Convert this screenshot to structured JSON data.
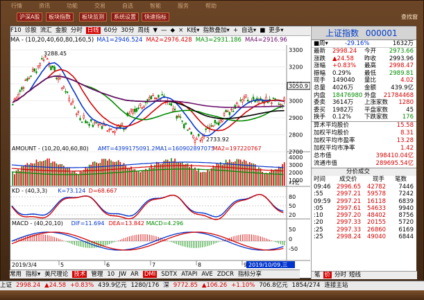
{
  "topmenu": {
    "buttons": [
      "沪深A股",
      "板块指数",
      "板块监测",
      "系统设置",
      "快速指标"
    ],
    "faint": [
      "行情",
      "资讯",
      "功能",
      "交易",
      "自选",
      "智能",
      "服务",
      "帮助"
    ],
    "corner": "查找窗"
  },
  "toolbar": {
    "items": [
      "F10",
      "诊股",
      "流汇",
      "金股",
      "分时",
      "日线",
      "60分",
      "30分",
      "周线",
      "▼",
      "—",
      "◆",
      "×",
      "K线▾",
      "指数叠加▾",
      "+",
      "自选▾",
      "■",
      "更多▾"
    ],
    "selected_index": 5
  },
  "ma_bar": {
    "label": "MA - (10,20,40,60,80,160,5)",
    "items": [
      {
        "text": "MA1=2946.524",
        "color": "#0033cc"
      },
      {
        "text": "MA2=2976.428",
        "color": "#d40000"
      },
      {
        "text": "MA3=2931.186",
        "color": "#008a00"
      },
      {
        "text": "MA4=2916.96",
        "color": "#6a0d6a"
      }
    ]
  },
  "price_axis": [
    "3300",
    "3200",
    "3100",
    "3000",
    "2900",
    "2800",
    "2700"
  ],
  "price_markers": {
    "high": "3288.45",
    "low": "2733.92",
    "current": "3050.9"
  },
  "volume_bar": {
    "label": "AMOUNT - (10,20,40,60,80)",
    "items": [
      {
        "text": "AMT=4399175091.2",
        "color": "#0033cc"
      },
      {
        "text": "MA1=160902897075",
        "color": "#0033cc"
      },
      {
        "text": "MA2=197220767",
        "color": "#d40000"
      }
    ],
    "axis": [
      "4000",
      "3000",
      "2000",
      "1000"
    ],
    "unit": "x1亿"
  },
  "kd_bar": {
    "label": "KD - (40,3,3)",
    "items": [
      {
        "text": "K=73.124",
        "color": "#0033cc"
      },
      {
        "text": "D=68.667",
        "color": "#d40000"
      }
    ],
    "axis": [
      "80",
      "50",
      "20"
    ]
  },
  "macd_bar": {
    "label": "MACD - (40,20,10)",
    "items": [
      {
        "text": "DIF=11.694",
        "color": "#0033cc"
      },
      {
        "text": "DEA=13.842",
        "color": "#d40000"
      },
      {
        "text": "MACD=4.296",
        "color": "#008a00"
      }
    ],
    "axis": [
      "50",
      "0",
      "-50"
    ]
  },
  "date_axis": {
    "left": "2019/3/4",
    "months": [
      "5",
      "6",
      "7",
      "8",
      "9"
    ],
    "highlight": "2019/10/09,三"
  },
  "side": {
    "title": "上证指数",
    "code": "000001",
    "week_selector": "■周▾",
    "change_pct_top": "-29.16%",
    "volume_top": "1632万",
    "quote": [
      {
        "l1": "最新",
        "v1": "2998.24",
        "c1": "red",
        "l2": "今开",
        "v2": "2973.66",
        "c2": "green"
      },
      {
        "l1": "涨跌",
        "v1": "▲24.58",
        "c1": "red",
        "l2": "昨收",
        "v2": "2993.96",
        "c2": "black"
      },
      {
        "l1": "涨幅",
        "v1": "+0.83%",
        "c1": "red",
        "l2": "最高",
        "v2": "2998.47",
        "c2": "red"
      },
      {
        "l1": "振幅",
        "v1": "0.29%",
        "c1": "black",
        "l2": "最低",
        "v2": "2989.81",
        "c2": "green"
      },
      {
        "l1": "现手",
        "v1": "149040",
        "c1": "black",
        "l2": "量比",
        "v2": "4.02",
        "c2": "red"
      },
      {
        "l1": "总量",
        "v1": "4026万",
        "c1": "black",
        "l2": "金额",
        "v2": "439.9亿",
        "c2": "black"
      },
      {
        "l1": "内盘",
        "v1": "18476980",
        "c1": "green",
        "l2": "外盘",
        "v2": "21784468",
        "c2": "red"
      },
      {
        "l1": "委卖",
        "v1": "3614万",
        "c1": "black",
        "l2": "上涨家数",
        "v2": "1280",
        "c2": "red"
      },
      {
        "l1": "委买",
        "v1": "1982万",
        "c1": "black",
        "l2": "平盘家数",
        "v2": "45",
        "c2": "black"
      },
      {
        "l1": "换手",
        "v1": "0.12%",
        "c1": "black",
        "l2": "下跌家数",
        "v2": "176",
        "c2": "green"
      }
    ],
    "stats": [
      {
        "label": "算术平均股价",
        "value": "15.58"
      },
      {
        "label": "加权平均股价",
        "value": "8.31"
      },
      {
        "label": "加权平均市盈率",
        "value": "13.28"
      },
      {
        "label": "加权平均市净率",
        "value": "1.42"
      },
      {
        "label": "总市值",
        "value": "398410.04亿"
      },
      {
        "label": "流通市值",
        "value": "289695.54亿"
      }
    ],
    "ticks_header": {
      "title": "分价成交",
      "cols": [
        "时间",
        "成交价",
        "现手",
        "笔数"
      ]
    },
    "ticks": [
      {
        "time": "09:46",
        "price": "2996.65",
        "vol": "42782",
        "count": "7446"
      },
      {
        "time": ":55",
        "price": "2997.21",
        "vol": "59578",
        "count": "7242"
      },
      {
        "time": "09:59",
        "price": "2997.21",
        "vol": "16118",
        "count": "6839"
      },
      {
        "time": ":05",
        "price": "2997.61",
        "vol": "54633",
        "count": "9940"
      },
      {
        "time": ":10",
        "price": "2997.20",
        "vol": "48402",
        "count": "8756"
      },
      {
        "time": ":20",
        "price": "2997.33",
        "vol": "20155",
        "count": "5720"
      },
      {
        "time": ":25",
        "price": "2997.33",
        "vol": "26860",
        "count": "6169"
      },
      {
        "time": ":25",
        "price": "2998.24",
        "vol": "49040",
        "count": "6844"
      }
    ],
    "tabs": [
      "笔",
      "价",
      "分时",
      "短线"
    ],
    "tabs_selected": 1
  },
  "bottom_tabs": {
    "items": [
      "常用",
      "指标▾",
      "美尺理论",
      "技术",
      "管理",
      "10",
      "JW",
      "AR",
      "DMI",
      "SDTX",
      "ATAPI",
      "AVE",
      "ZDCR",
      "指标分享"
    ],
    "selected": [
      3,
      8
    ]
  },
  "ticker": [
    {
      "text": "上证",
      "color": "#000"
    },
    {
      "text": "2998.24",
      "color": "#d40000"
    },
    {
      "text": "▲24.58",
      "color": "#d40000"
    },
    {
      "text": "+0.83%",
      "color": "#d40000"
    },
    {
      "text": "439.9亿元",
      "color": "#000"
    },
    {
      "text": "1280/176",
      "color": "#000"
    },
    {
      "text": "深",
      "color": "#000"
    },
    {
      "text": "9772.85",
      "color": "#d40000"
    },
    {
      "text": "▲106.26",
      "color": "#d40000"
    },
    {
      "text": "+1.10%",
      "color": "#d40000"
    },
    {
      "text": "706.8亿元",
      "color": "#000"
    },
    {
      "text": "1854/274",
      "color": "#000"
    },
    {
      "text": "连接主站",
      "color": "#000"
    }
  ],
  "colors": {
    "ma1": "#0033cc",
    "ma2": "#d40000",
    "ma3": "#008a00",
    "ma4": "#6a0d6a",
    "ma5": "#000000",
    "up": "#d40000",
    "down": "#008a00"
  }
}
